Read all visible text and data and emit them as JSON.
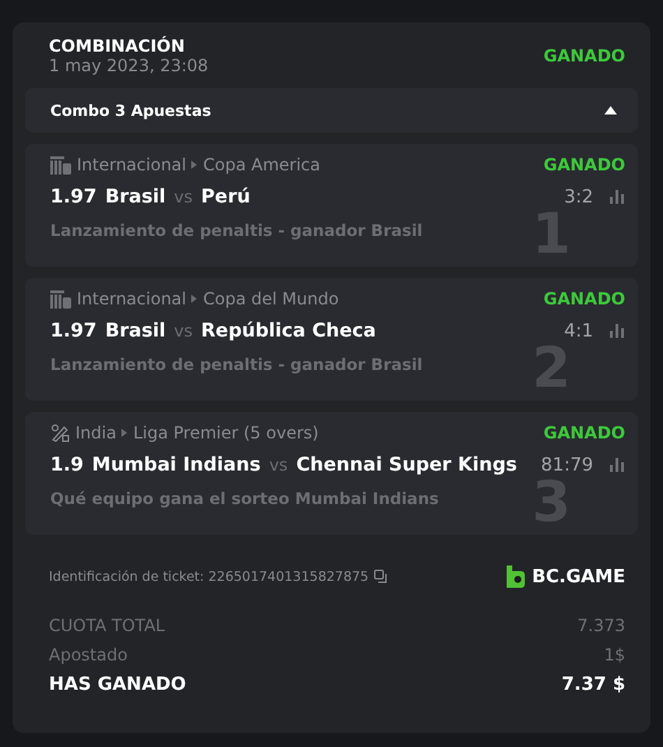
{
  "header": {
    "title": "COMBINACIÓN",
    "date": "1 may 2023, 23:08",
    "status": "GANADO"
  },
  "combo": {
    "label": "Combo 3 Apuestas",
    "expanded": true
  },
  "bets": [
    {
      "kind": "fifa",
      "region": "Internacional",
      "league": "Copa America",
      "status": "GANADO",
      "odds": "1.97",
      "home": "Brasil",
      "vs": "vs",
      "away": "Perú",
      "score": "3:2",
      "market": "Lanzamiento de penaltis - ganador Brasil",
      "index": "1"
    },
    {
      "kind": "fifa",
      "region": "Internacional",
      "league": "Copa del Mundo",
      "status": "GANADO",
      "odds": "1.97",
      "home": "Brasil",
      "vs": "vs",
      "away": "República Checa",
      "score": "4:1",
      "market": "Lanzamiento de penaltis - ganador Brasil",
      "index": "2"
    },
    {
      "kind": "cricket",
      "region": "India",
      "league": "Liga Premier (5 overs)",
      "status": "GANADO",
      "odds": "1.9",
      "home": "Mumbai Indians",
      "vs": "vs",
      "away": "Chennai Super Kings",
      "score": "81:79",
      "market": "Qué equipo gana el sorteo Mumbai Indians",
      "index": "3"
    }
  ],
  "ticket": {
    "label": "Identificación de ticket: 2265017401315827875",
    "brand": "BC.GAME"
  },
  "totals": [
    {
      "kind": "plain",
      "label": "CUOTA TOTAL",
      "value": "7.373"
    },
    {
      "kind": "plain",
      "label": "Apostado",
      "value": "1$"
    },
    {
      "kind": "strong",
      "label": "HAS GANADO",
      "value": "7.37 $"
    }
  ]
}
